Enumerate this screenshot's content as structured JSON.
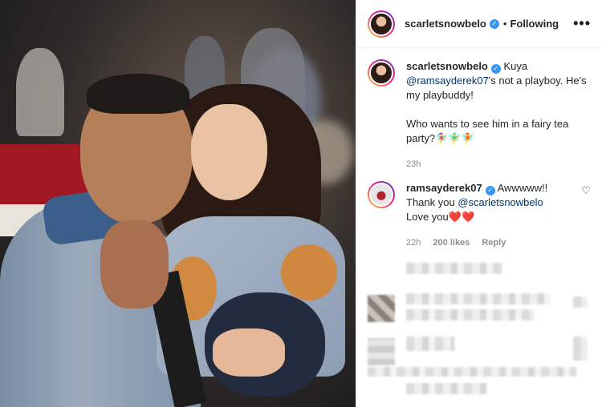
{
  "post": {
    "owner": "scarletsnowbelo",
    "follow_sep": "•",
    "follow_label": "Following",
    "more_label": "•••",
    "verified_glyph": "✓"
  },
  "caption": {
    "author": "scarletsnowbelo",
    "text_1": "Kuya",
    "mention": "@ramsayderek07",
    "text_2": "'s not a playboy. He's my playbuddy!",
    "text_3": "Who wants to see him in a fairy tea party?🧚‍♀️🧚‍♂️🧚",
    "time": "23h"
  },
  "reply": {
    "author": "ramsayderek07",
    "text_1": "Awwwww!!",
    "text_2": "Thank you",
    "mention": "@scarletsnowbelo",
    "text_3": "Love you❤️❤️",
    "time": "22h",
    "likes": "200 likes",
    "reply_label": "Reply",
    "heart_icon": "♡"
  },
  "colors": {
    "verified": "#3897f0",
    "mention": "#003569",
    "meta": "#8e8e8e"
  }
}
